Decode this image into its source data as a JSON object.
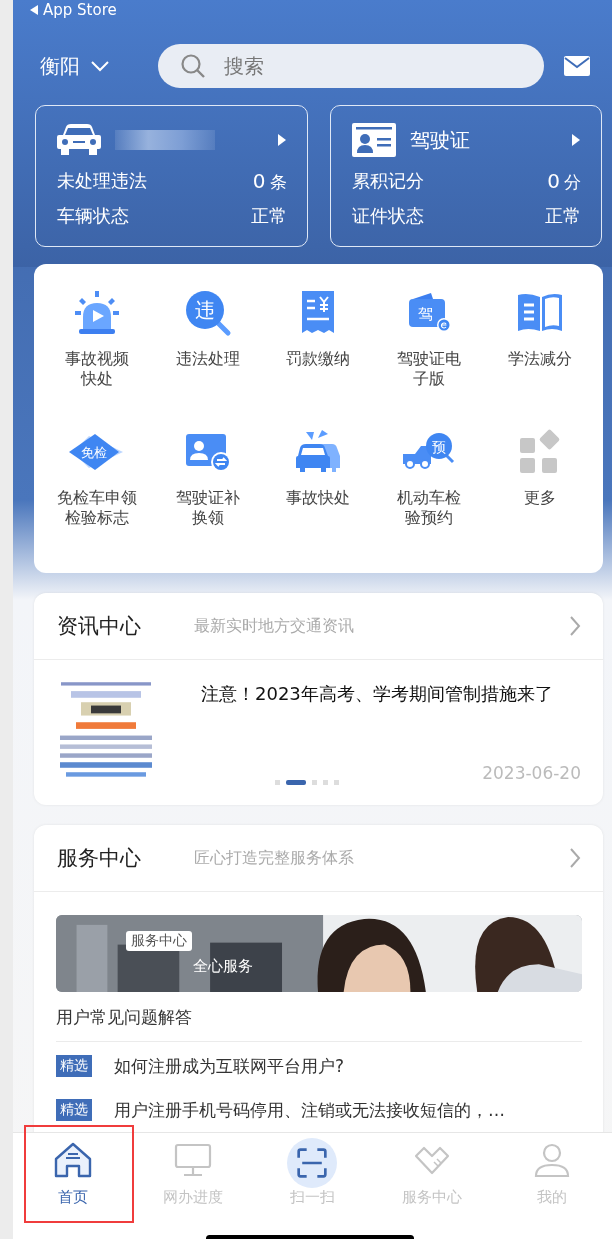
{
  "status_bar": {
    "back_label": "App Store"
  },
  "header": {
    "city": "衡阳",
    "search": {
      "placeholder": "搜索"
    }
  },
  "summary_cards": [
    {
      "kind": "vehicle",
      "redacted": true,
      "rows": [
        {
          "label": "未处理违法",
          "value": "0",
          "unit": "条"
        },
        {
          "label": "车辆状态",
          "value": "正常"
        }
      ]
    },
    {
      "kind": "license",
      "title": "驾驶证",
      "redacted": false,
      "rows": [
        {
          "label": "累积记分",
          "value": "0",
          "unit": "分"
        },
        {
          "label": "证件状态",
          "value": "正常"
        }
      ]
    }
  ],
  "services": [
    {
      "label": "事故视频快处"
    },
    {
      "label": "违法处理",
      "badge": "违"
    },
    {
      "label": "罚款缴纳"
    },
    {
      "label": "驾驶证电子版",
      "badge": "驾"
    },
    {
      "label": "学法减分"
    },
    {
      "label": "免检车申领检验标志",
      "badge": "免检"
    },
    {
      "label": "驾驶证补换领"
    },
    {
      "label": "事故快处"
    },
    {
      "label": "机动车检验预约",
      "badge": "预"
    },
    {
      "label": "更多"
    }
  ],
  "news": {
    "title": "资讯中心",
    "subtitle": "最新实时地方交通资讯",
    "article": {
      "kind": "picture",
      "headline": "注意！2023年高考、学考期间管制措施来了",
      "date": "2023-06-20"
    },
    "pages": [
      {
        "selected": false
      },
      {
        "selected": true
      },
      {
        "selected": false
      },
      {
        "selected": false
      },
      {
        "selected": false
      }
    ]
  },
  "service_center": {
    "title": "服务中心",
    "subtitle": "匠心打造完整服务体系",
    "banner": {
      "tag": "服务中心",
      "caption": "全心服务"
    },
    "faq_title": "用户常见问题解答",
    "faqs": [
      {
        "tag": "精选",
        "text": "如何注册成为互联网平台用户?"
      },
      {
        "tag": "精选",
        "text": "用户注册手机号码停用、注销或无法接收短信的，…"
      }
    ]
  },
  "tab_bar": [
    {
      "label": "首页",
      "selected": true,
      "highlighted": true
    },
    {
      "label": "网办进度",
      "selected": false,
      "highlighted": false
    },
    {
      "label": "扫一扫",
      "selected": false,
      "highlighted": false
    },
    {
      "label": "服务中心",
      "selected": false,
      "highlighted": false
    },
    {
      "label": "我的",
      "selected": false,
      "highlighted": false
    }
  ]
}
